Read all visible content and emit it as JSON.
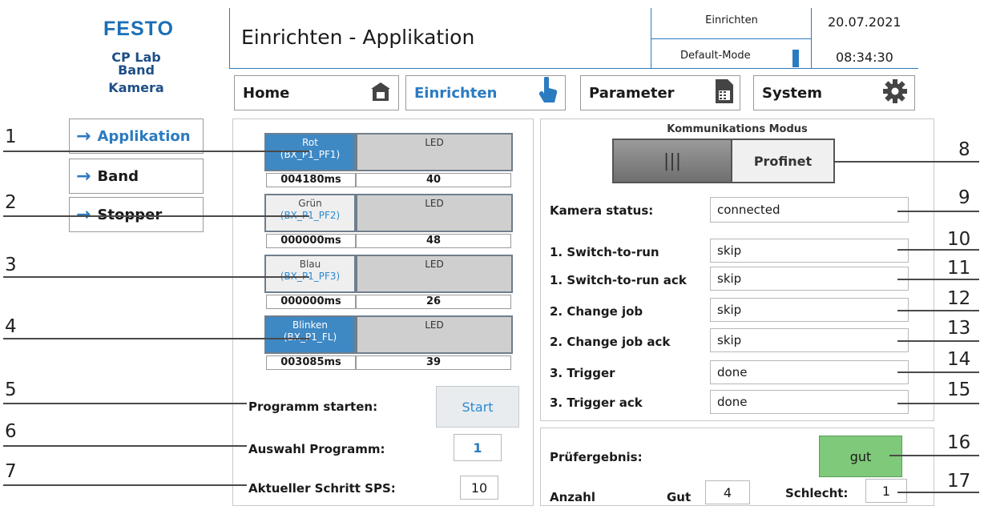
{
  "brand": {
    "logo": "FESTO",
    "line1": "CP Lab",
    "line2": "Band",
    "line3": "Kamera"
  },
  "header": {
    "title": "Einrichten - Applikation",
    "mode_label": "Einrichten",
    "mode_value": "Default-Mode",
    "date": "20.07.2021",
    "time": "08:34:30"
  },
  "nav": [
    {
      "label": "Home",
      "icon": "house-icon"
    },
    {
      "label": "Einrichten",
      "icon": "hand-pointer-icon"
    },
    {
      "label": "Parameter",
      "icon": "document-icon"
    },
    {
      "label": "System",
      "icon": "gear-icon"
    }
  ],
  "sidebar": [
    {
      "label": "Applikation"
    },
    {
      "label": "Band"
    },
    {
      "label": "Stopper"
    }
  ],
  "leds": [
    {
      "name": "Rot",
      "sub": "(BX_P1_PF1)",
      "led": "LED",
      "time": "004180ms",
      "value": "40",
      "active": true
    },
    {
      "name": "Grün",
      "sub": "(BX_P1_PF2)",
      "led": "LED",
      "time": "000000ms",
      "value": "48",
      "active": false
    },
    {
      "name": "Blau",
      "sub": "(BX_P1_PF3)",
      "led": "LED",
      "time": "000000ms",
      "value": "26",
      "active": false
    },
    {
      "name": "Blinken",
      "sub": "(BX_P1_FL)",
      "led": "LED",
      "time": "003085ms",
      "value": "39",
      "active": true
    }
  ],
  "program": {
    "start_label": "Programm starten:",
    "start_button": "Start",
    "select_label": "Auswahl Programm:",
    "select_value": "1",
    "step_label": "Aktueller Schritt SPS:",
    "step_value": "10"
  },
  "comm": {
    "title": "Kommunikations Modus",
    "toggle_icon": "|||",
    "mode": "Profinet",
    "status_label": "Kamera status:",
    "status_value": "connected",
    "rows": [
      {
        "label": "1. Switch-to-run",
        "value": "skip"
      },
      {
        "label": "1. Switch-to-run ack",
        "value": "skip"
      },
      {
        "label": "2. Change job",
        "value": "skip"
      },
      {
        "label": "2. Change job  ack",
        "value": "skip"
      },
      {
        "label": "3. Trigger",
        "value": "done"
      },
      {
        "label": "3. Trigger ack",
        "value": "done"
      }
    ]
  },
  "result": {
    "label": "Prüfergebnis:",
    "value": "gut",
    "value_color": "#7fc97a",
    "count_label": "Anzahl",
    "good_label": "Gut",
    "good_value": "4",
    "bad_label": "Schlecht:",
    "bad_value": "1"
  },
  "callouts": [
    "1",
    "2",
    "3",
    "4",
    "5",
    "6",
    "7",
    "8",
    "9",
    "10",
    "11",
    "12",
    "13",
    "14",
    "15",
    "16",
    "17"
  ]
}
